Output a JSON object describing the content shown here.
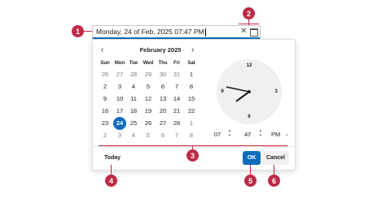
{
  "input": {
    "value": "Monday, 24 of Feb, 2025 07:47 PM"
  },
  "icons": {
    "clear": "close-icon",
    "calendar": "calendar-icon",
    "prev": "chevron-left-icon",
    "next": "chevron-right-icon"
  },
  "calendar": {
    "month_title": "February 2025",
    "prev_label": "‹",
    "next_label": "›",
    "weekdays": [
      "Sun",
      "Mon",
      "Tue",
      "Wed",
      "Thu",
      "Fri",
      "Sat"
    ],
    "weeks": [
      [
        "26",
        "27",
        "28",
        "29",
        "30",
        "31",
        "1"
      ],
      [
        "2",
        "3",
        "4",
        "5",
        "6",
        "7",
        "8"
      ],
      [
        "9",
        "10",
        "11",
        "12",
        "13",
        "14",
        "15"
      ],
      [
        "16",
        "17",
        "18",
        "19",
        "20",
        "21",
        "22"
      ],
      [
        "23",
        "24",
        "25",
        "26",
        "27",
        "28",
        "1"
      ],
      [
        "2",
        "3",
        "4",
        "5",
        "6",
        "7",
        "8"
      ]
    ],
    "selected_day": "24"
  },
  "clock": {
    "numbers": {
      "twelve": "12",
      "three": "3",
      "six": "6",
      "nine": "9"
    },
    "hour": 7,
    "minute": 47
  },
  "time": {
    "hour": "07",
    "minute": "47",
    "meridiem": "PM",
    "separator": ":"
  },
  "buttons": {
    "today": "Today",
    "ok": "OK",
    "cancel": "Cancel"
  },
  "annotations": [
    "1",
    "2",
    "3",
    "4",
    "5",
    "6"
  ],
  "colors": {
    "accent": "#0f6cbd",
    "annotation": "#bd2b46"
  }
}
